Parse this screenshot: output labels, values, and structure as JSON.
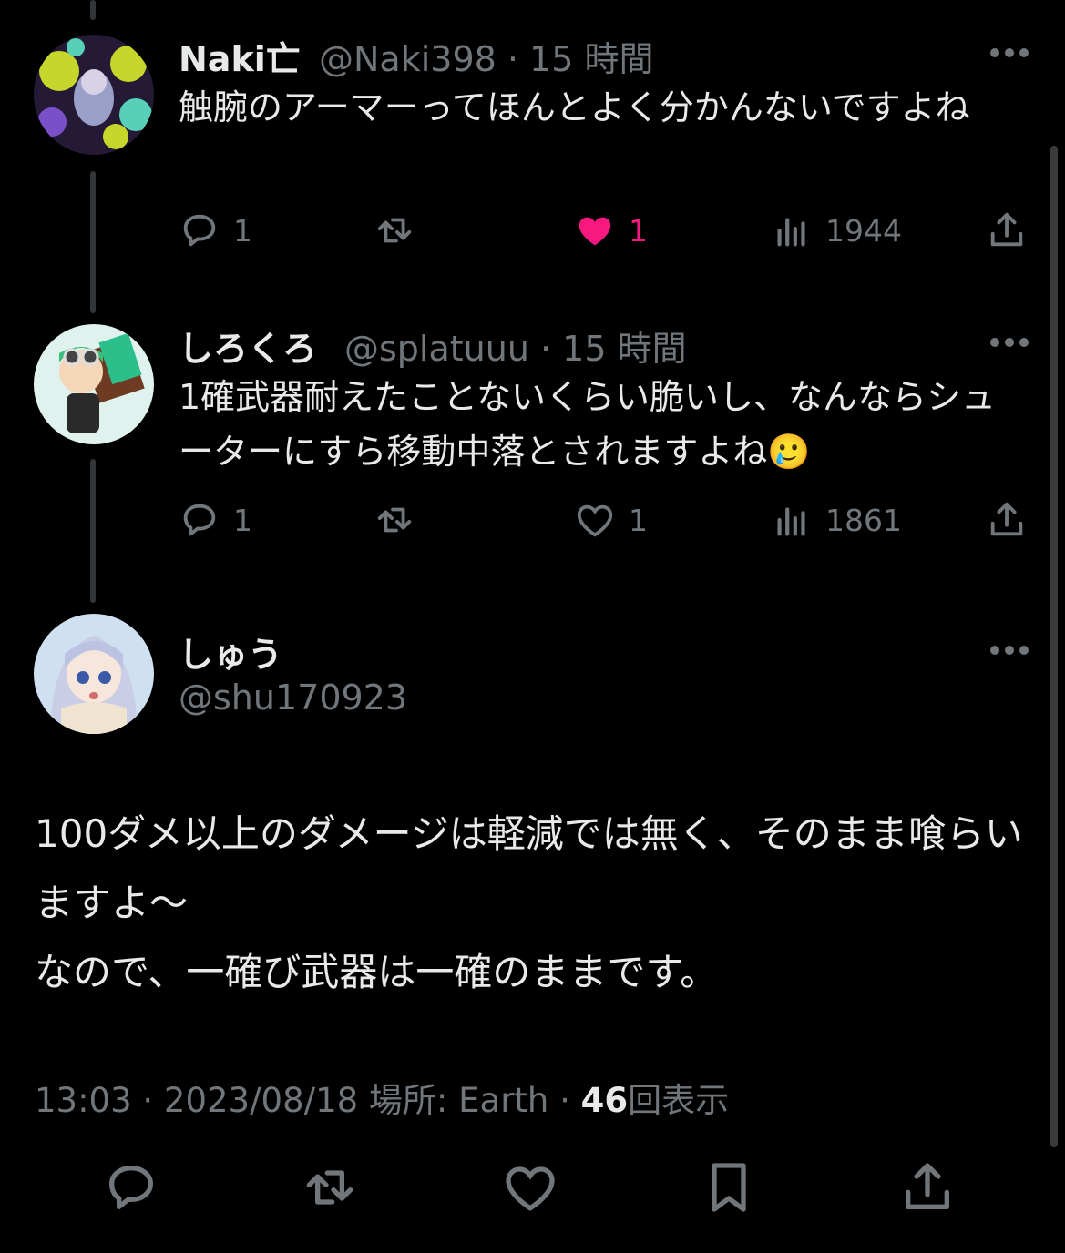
{
  "tweets": [
    {
      "name": "Naki亡",
      "handle": "@Naki398 · 15 時間",
      "text": "触腕のアーマーってほんとよく分かんないですよね",
      "replies": "1",
      "likes": "1",
      "liked": true,
      "views": "1944"
    },
    {
      "name": "しろくろ",
      "handle": "@splatuuu · 15 時間",
      "text": "1確武器耐えたことないくらい脆いし、なんならシューターにすら移動中落とされますよね🥲",
      "replies": "1",
      "likes": "1",
      "liked": false,
      "views": "1861"
    }
  ],
  "main_tweet": {
    "name": "しゅう",
    "handle": "@shu170923",
    "text": "100ダメ以上のダメージは軽減では無く、そのまま喰らいますよ〜\nなので、一確び武器は一確のままです。",
    "time": "13:03 · 2023/08/18 場所: Earth · ",
    "view_count": "46",
    "view_label": "回表示"
  },
  "icons": [
    "reply-icon",
    "retweet-icon",
    "like-icon",
    "views-icon",
    "share-icon",
    "bookmark-icon",
    "more-icon"
  ],
  "colors": {
    "background": "#000000",
    "text": "#e7e9ea",
    "muted": "#71767b",
    "like": "#f91880"
  }
}
